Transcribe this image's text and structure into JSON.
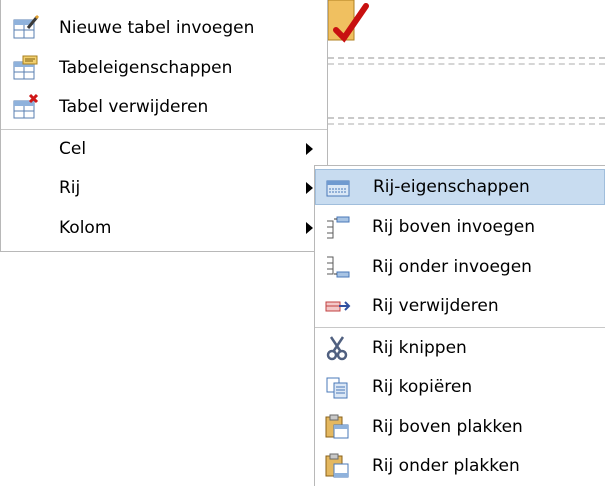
{
  "main_menu": {
    "items": [
      {
        "label": "Nieuwe tabel invoegen",
        "icon": "insert-table-icon"
      },
      {
        "label": "Tabeleigenschappen",
        "icon": "table-properties-icon"
      },
      {
        "label": "Tabel verwijderen",
        "icon": "delete-table-icon"
      },
      {
        "label": "Cel",
        "submenu": true
      },
      {
        "label": "Rij",
        "submenu": true,
        "active": true
      },
      {
        "label": "Kolom",
        "submenu": true
      }
    ]
  },
  "row_submenu": {
    "items": [
      {
        "label": "Rij-eigenschappen",
        "icon": "row-properties-icon",
        "highlighted": true
      },
      {
        "label": "Rij boven invoegen",
        "icon": "insert-row-above-icon"
      },
      {
        "label": "Rij onder invoegen",
        "icon": "insert-row-below-icon"
      },
      {
        "label": "Rij verwijderen",
        "icon": "delete-row-icon"
      },
      {
        "label": "Rij knippen",
        "icon": "cut-icon"
      },
      {
        "label": "Rij kopiëren",
        "icon": "copy-icon"
      },
      {
        "label": "Rij boven plakken",
        "icon": "paste-above-icon"
      },
      {
        "label": "Rij onder plakken",
        "icon": "paste-below-icon"
      }
    ]
  },
  "colors": {
    "highlight": "#c8dcf0",
    "menu_border": "#b8b8b8"
  }
}
